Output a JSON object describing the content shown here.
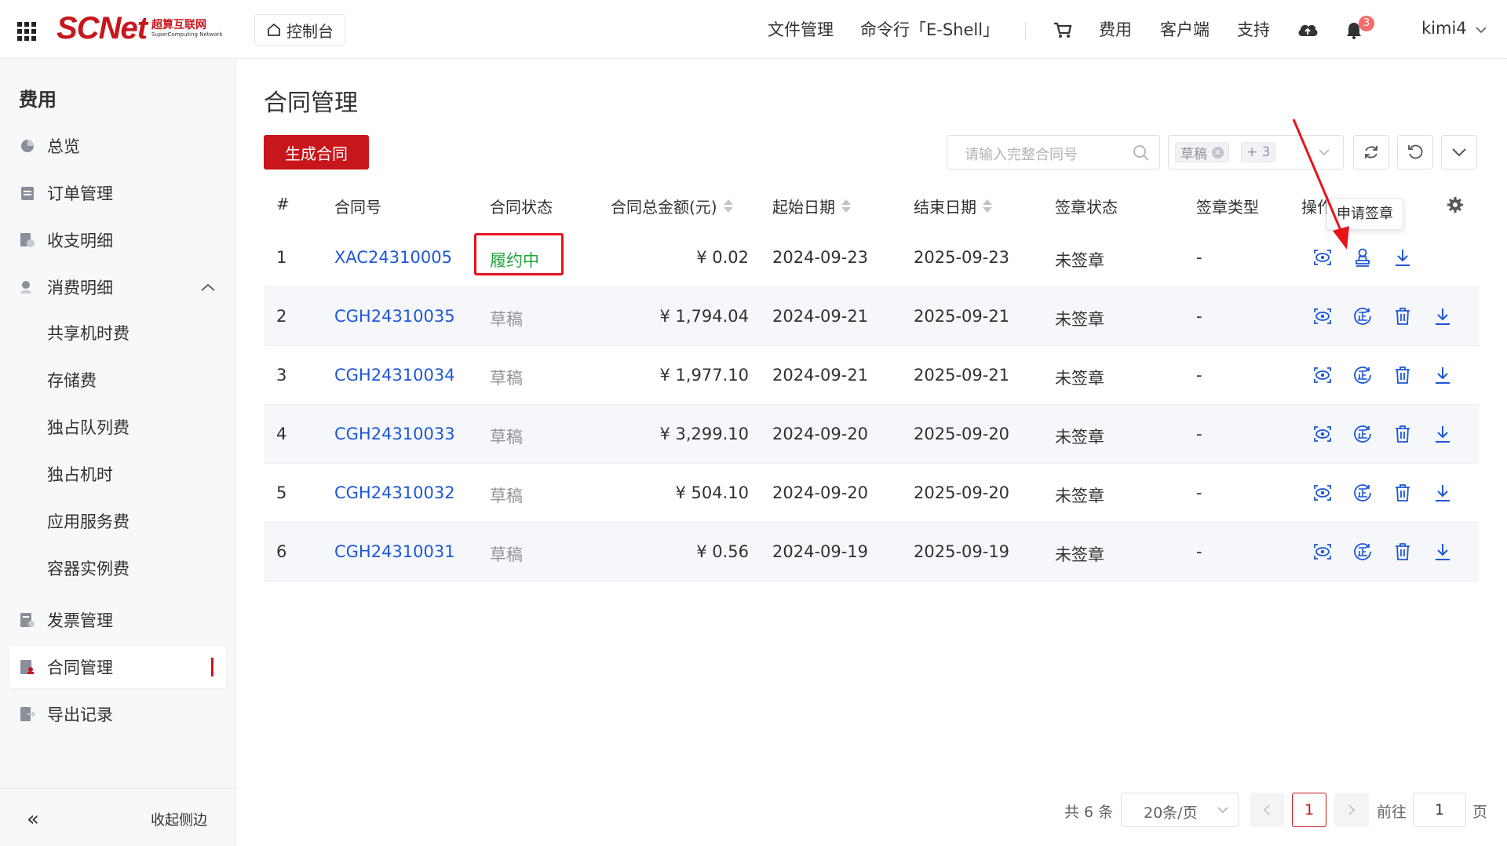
{
  "header": {
    "logo_text": "SCNet",
    "logo_cn": "超算互联网",
    "logo_en": "SuperComputing Network",
    "console": "控制台",
    "nav": [
      "文件管理",
      "命令行「E-Shell」",
      "费用",
      "客户端",
      "支持"
    ],
    "notification_count": "3",
    "user": "kimi4"
  },
  "sidebar": {
    "title": "费用",
    "items": [
      {
        "label": "总览",
        "icon": "pie-chart-icon"
      },
      {
        "label": "订单管理",
        "icon": "clipboard-icon"
      },
      {
        "label": "收支明细",
        "icon": "ledger-icon"
      },
      {
        "label": "消费明细",
        "icon": "consumption-icon"
      },
      {
        "label": "共享机时费"
      },
      {
        "label": "存储费"
      },
      {
        "label": "独占队列费"
      },
      {
        "label": "独占机时"
      },
      {
        "label": "应用服务费"
      },
      {
        "label": "容器实例费"
      },
      {
        "label": "发票管理",
        "icon": "invoice-icon"
      },
      {
        "label": "合同管理",
        "icon": "contract-icon"
      },
      {
        "label": "导出记录",
        "icon": "export-icon"
      }
    ],
    "collapse_label": "收起侧边"
  },
  "main": {
    "title": "合同管理",
    "generate_button": "生成合同",
    "search_placeholder": "请输入完整合同号",
    "filter_tag": "草稿",
    "filter_more": "+ 3",
    "tooltip": "申请签章"
  },
  "table": {
    "columns": [
      "#",
      "合同号",
      "合同状态",
      "合同总金额(元)",
      "起始日期",
      "结束日期",
      "签章状态",
      "签章类型",
      "操作"
    ],
    "rows": [
      {
        "no": "1",
        "contract": "XAC24310005",
        "status": "履约中",
        "amount": "¥ 0.02",
        "start": "2024-09-23",
        "end": "2025-09-23",
        "sign_status": "未签章",
        "sign_type": "-"
      },
      {
        "no": "2",
        "contract": "CGH24310035",
        "status": "草稿",
        "amount": "¥ 1,794.04",
        "start": "2024-09-21",
        "end": "2025-09-21",
        "sign_status": "未签章",
        "sign_type": "-"
      },
      {
        "no": "3",
        "contract": "CGH24310034",
        "status": "草稿",
        "amount": "¥ 1,977.10",
        "start": "2024-09-21",
        "end": "2025-09-21",
        "sign_status": "未签章",
        "sign_type": "-"
      },
      {
        "no": "4",
        "contract": "CGH24310033",
        "status": "草稿",
        "amount": "¥ 3,299.10",
        "start": "2024-09-20",
        "end": "2025-09-20",
        "sign_status": "未签章",
        "sign_type": "-"
      },
      {
        "no": "5",
        "contract": "CGH24310032",
        "status": "草稿",
        "amount": "¥ 504.10",
        "start": "2024-09-20",
        "end": "2025-09-20",
        "sign_status": "未签章",
        "sign_type": "-"
      },
      {
        "no": "6",
        "contract": "CGH24310031",
        "status": "草稿",
        "amount": "¥ 0.56",
        "start": "2024-09-19",
        "end": "2025-09-19",
        "sign_status": "未签章",
        "sign_type": "-"
      }
    ]
  },
  "pagination": {
    "total": "共 6 条",
    "page_size": "20条/页",
    "current": "1",
    "goto_label": "前往",
    "goto_value": "1",
    "page_suffix": "页"
  },
  "colors": {
    "brand": "#c8161d",
    "link": "#1f57d6",
    "performing": "#22a53c",
    "highlight": "#e8141c"
  }
}
